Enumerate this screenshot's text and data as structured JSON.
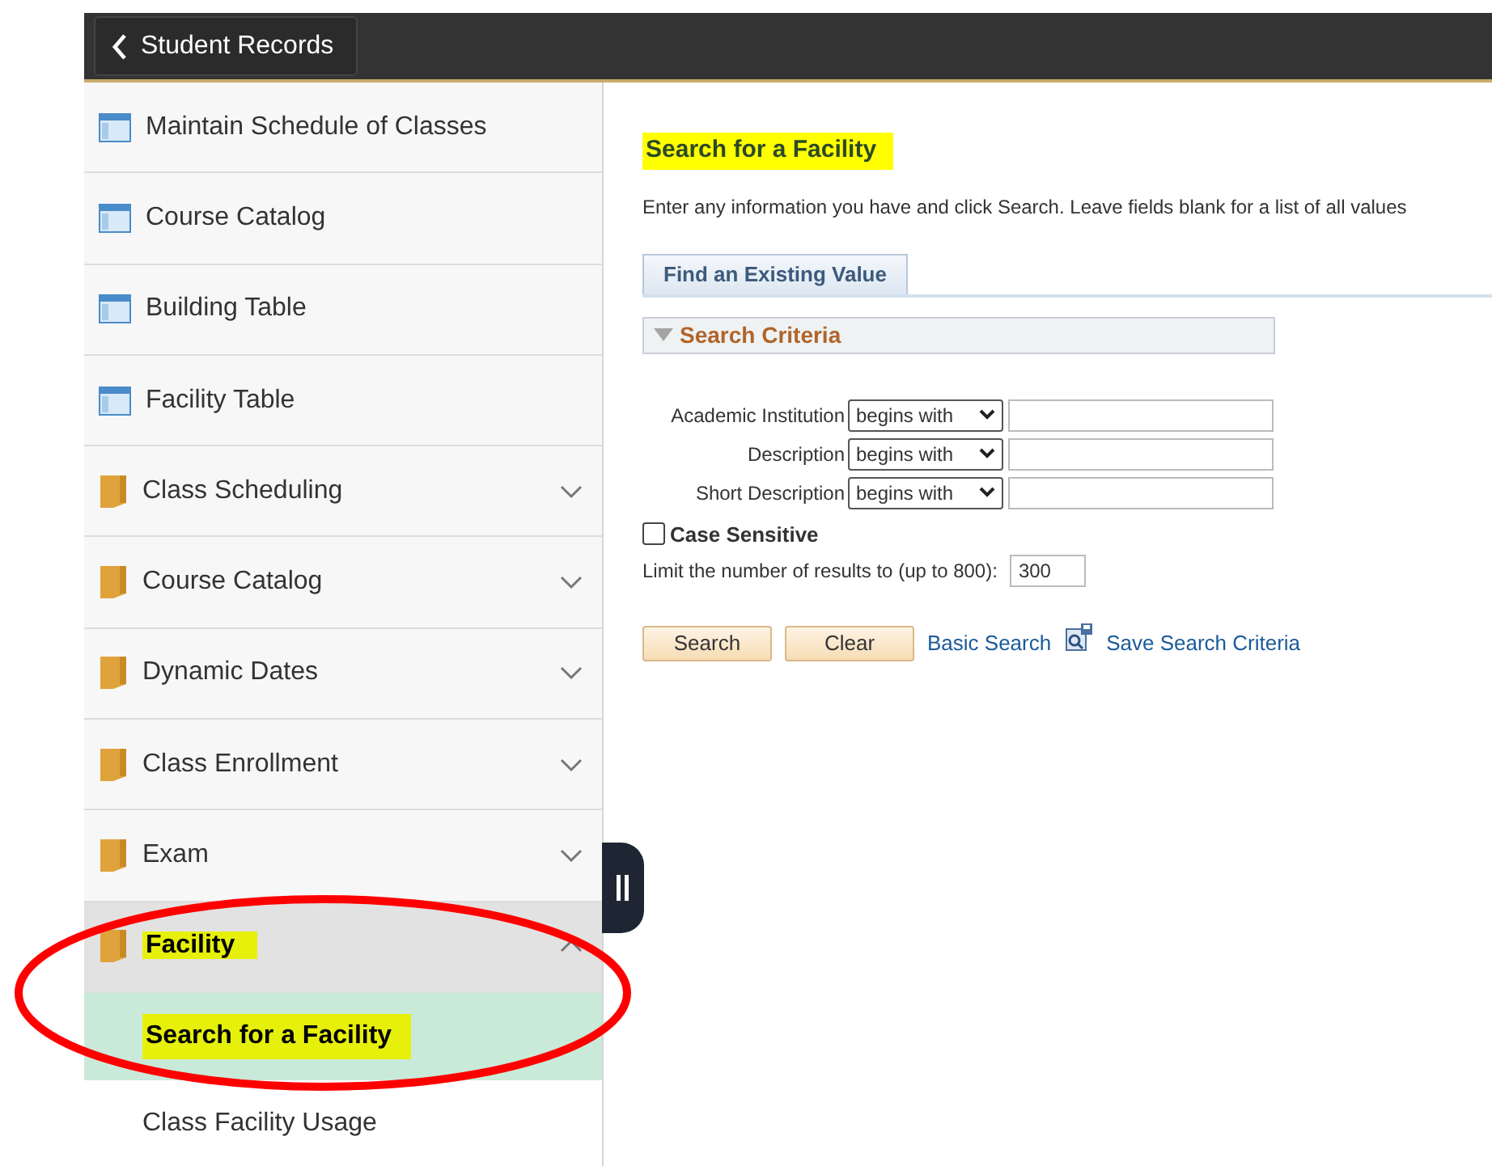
{
  "header": {
    "back_label": "Student Records"
  },
  "sidebar": {
    "items": [
      {
        "kind": "page",
        "label": "Maintain Schedule of Classes",
        "expanded": false,
        "highlighted": false
      },
      {
        "kind": "page",
        "label": "Course Catalog",
        "expanded": false,
        "highlighted": false
      },
      {
        "kind": "page",
        "label": "Building Table",
        "expanded": false,
        "highlighted": false
      },
      {
        "kind": "page",
        "label": "Facility Table",
        "expanded": false,
        "highlighted": false
      },
      {
        "kind": "folder",
        "label": "Class Scheduling",
        "expanded": false,
        "highlighted": false
      },
      {
        "kind": "folder",
        "label": "Course Catalog",
        "expanded": false,
        "highlighted": false
      },
      {
        "kind": "folder",
        "label": "Dynamic Dates",
        "expanded": false,
        "highlighted": false
      },
      {
        "kind": "folder",
        "label": "Class Enrollment",
        "expanded": false,
        "highlighted": false
      },
      {
        "kind": "folder",
        "label": "Exam",
        "expanded": false,
        "highlighted": false
      },
      {
        "kind": "folder",
        "label": "Facility",
        "expanded": true,
        "highlighted": true,
        "children": [
          {
            "label": "Search for a Facility",
            "selected": true,
            "highlighted": true
          },
          {
            "label": "Class Facility Usage",
            "selected": false,
            "highlighted": false
          }
        ]
      }
    ]
  },
  "main": {
    "title": "Search for a Facility",
    "title_highlighted": true,
    "instructions": "Enter any information you have and click Search. Leave fields blank for a list of all values",
    "tabs": [
      {
        "label": "Find an Existing Value",
        "selected": true
      }
    ],
    "section": {
      "title": "Search Criteria",
      "expanded": true
    },
    "fields": [
      {
        "label": "Academic Institution",
        "operator": "begins with"
      },
      {
        "label": "Description",
        "operator": "begins with"
      },
      {
        "label": "Short Description",
        "operator": "begins with"
      }
    ],
    "case_sensitive": {
      "label": "Case Sensitive",
      "checked": false
    },
    "limit": {
      "label": "Limit the number of results to (up to 800):",
      "value": "300"
    },
    "buttons": [
      "Search",
      "Clear"
    ],
    "links": [
      {
        "kind": "plain",
        "label": "Basic Search"
      },
      {
        "kind": "save",
        "label": "Save Search Criteria"
      }
    ]
  },
  "annotations": [
    {
      "kind": "ellipse",
      "color": "#ff0000"
    }
  ]
}
